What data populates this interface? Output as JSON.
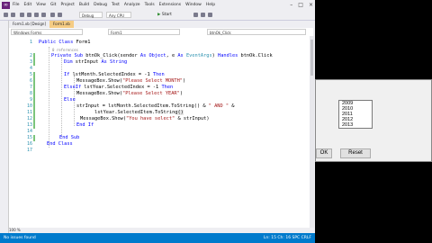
{
  "menu": [
    "File",
    "Edit",
    "View",
    "Git",
    "Project",
    "Build",
    "Debug",
    "Test",
    "Analyze",
    "Tools",
    "Extensions",
    "Window",
    "Help"
  ],
  "toolbar": {
    "config": "Debug",
    "platform": "Any CPU",
    "start_label": "Start"
  },
  "tabs": [
    "Form1.vb [Design]",
    "Form1.vb"
  ],
  "navbar": {
    "project": "Windows Forms",
    "class": "Form1",
    "member": "btnOk_Click"
  },
  "lines": {
    "n1": "1",
    "n2": "2",
    "n3": "3",
    "n4": "4",
    "n5": "5",
    "n6": "6",
    "n7": "7",
    "n8": "8",
    "n9": "9",
    "n10": "10",
    "n11": "11",
    "n12": "12",
    "n13": "13",
    "n14": "14",
    "n15": "15",
    "n16": "16",
    "n17": "17",
    "ref_line1": "0 references",
    "ref_line2": "0 references",
    "l1_kw": "Public Class",
    "l1_name": " Form1",
    "l2_kw1": "Private Sub",
    "l2_rest": " btnOk_Click(sender ",
    "l2_as1": "As",
    "l2_obj": " Object",
    "l2_comma": ", e ",
    "l2_as2": "As",
    "l2_args": " EventArgs",
    "l2_close": ") ",
    "l2_handles": "Handles",
    "l2_end": " btnOk.Click",
    "l3_dim": "Dim",
    "l3_rest": " strInput ",
    "l3_as": "As",
    "l3_str": " String",
    "l5_if": "If",
    "l5_rest": " lstMonth.SelectedIndex = -1 ",
    "l5_then": "Then",
    "l6_a": "MessageBox.Show(",
    "l6_s": "\"Please Select MONTH\"",
    "l6_b": ")",
    "l7_elseif": "ElseIf",
    "l7_rest": " lstYear.SelectedIndex = -1 ",
    "l7_then": "Then",
    "l8_a": "MessageBox.Show(",
    "l8_s": "\"Please Select YEAR\"",
    "l8_b": ")",
    "l9_else": "Else",
    "l10_a": "strInput = lstMonth.SelectedItem.ToString() & ",
    "l10_s": "\" AND \"",
    "l10_b": " &",
    "l11_a": "lstYear.SelectedItem.ToString",
    "l11_b": "()",
    "l12_a": "MessageBox.Show(",
    "l12_s": "\"You have select\"",
    "l12_b": " & strInput)",
    "l13_end": "End If",
    "l15_end": "End Sub",
    "l16_end": "End Class"
  },
  "status": {
    "left": "No issues found",
    "right": "Ln: 15  Ch: 16  SPC  CRLF"
  },
  "bottom": {
    "zoom": "100 %"
  },
  "form": {
    "years": [
      "2009",
      "2010",
      "2011",
      "2012",
      "2013"
    ],
    "ok_label": "OK",
    "reset_label": "Reset"
  }
}
